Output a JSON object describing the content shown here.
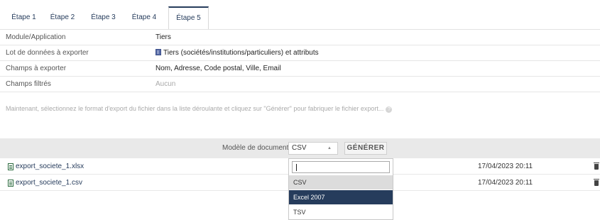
{
  "tabs": [
    "Étape 1",
    "Étape 2",
    "Étape 3",
    "Étape 4",
    "Étape 5"
  ],
  "info": {
    "module": {
      "label": "Module/Application",
      "value": "Tiers"
    },
    "lot": {
      "label": "Lot de données à exporter",
      "value": "Tiers (sociétés/institutions/particuliers) et attributs"
    },
    "champs": {
      "label": "Champs à exporter",
      "value": "Nom, Adresse, Code postal, Ville, Email"
    },
    "filtres": {
      "label": "Champs filtrés",
      "value": "Aucun"
    }
  },
  "help_text": "Maintenant, sélectionnez le format d'export du fichier dans la liste déroulante et cliquez sur \"Générer\" pour fabriquer le fichier export...",
  "generate": {
    "label": "Modèle de document",
    "selected": "CSV",
    "button": "GÉNÉRER"
  },
  "files": [
    {
      "name": "export_societe_1.xlsx",
      "date": "17/04/2023 20:11"
    },
    {
      "name": "export_societe_1.csv",
      "date": "17/04/2023 20:11"
    }
  ],
  "dropdown": {
    "options": [
      "CSV",
      "Excel 2007",
      "TSV"
    ]
  },
  "colors": {
    "accent": "#263c5c",
    "bar": "#e9e9e9"
  }
}
